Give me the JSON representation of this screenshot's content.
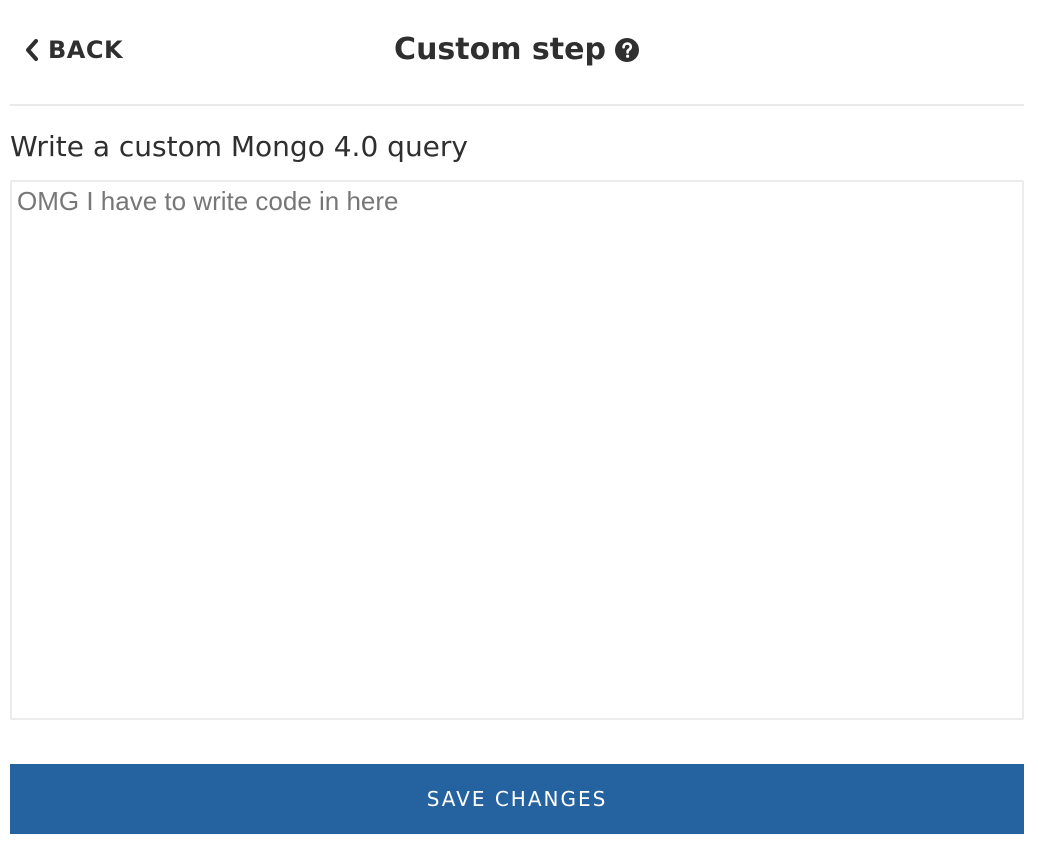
{
  "header": {
    "back_label": "BACK",
    "back_icon": "chevron-left-icon",
    "title": "Custom step",
    "help_icon": "question-circle-icon"
  },
  "query": {
    "label": "Write a custom Mongo 4.0 query",
    "value": "",
    "placeholder": "OMG I have to write code in here"
  },
  "actions": {
    "save_label": "SAVE CHANGES"
  },
  "colors": {
    "primary_button": "#2563a0",
    "text": "#2f2f2f",
    "placeholder": "#777777",
    "divider": "#e9e9e9"
  }
}
